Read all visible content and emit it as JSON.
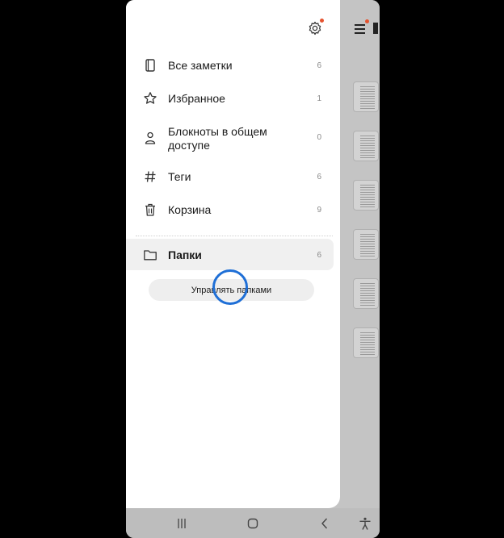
{
  "drawer": {
    "items": [
      {
        "label": "Все заметки",
        "count": "6",
        "icon": "notebook-icon"
      },
      {
        "label": "Избранное",
        "count": "1",
        "icon": "star-icon"
      },
      {
        "label": "Блокноты в общем доступе",
        "count": "0",
        "icon": "person-icon"
      },
      {
        "label": "Теги",
        "count": "6",
        "icon": "hash-icon"
      },
      {
        "label": "Корзина",
        "count": "9",
        "icon": "trash-icon"
      }
    ],
    "folders": {
      "label": "Папки",
      "count": "6",
      "icon": "folder-icon"
    },
    "manage_folders_label": "Управлять папками"
  },
  "colors": {
    "touch_indicator": "#1f6fd6",
    "notification_dot": "#e5532f"
  },
  "navbar": {
    "icons": [
      "recent-apps-icon",
      "home-icon",
      "back-icon",
      "accessibility-icon"
    ]
  }
}
